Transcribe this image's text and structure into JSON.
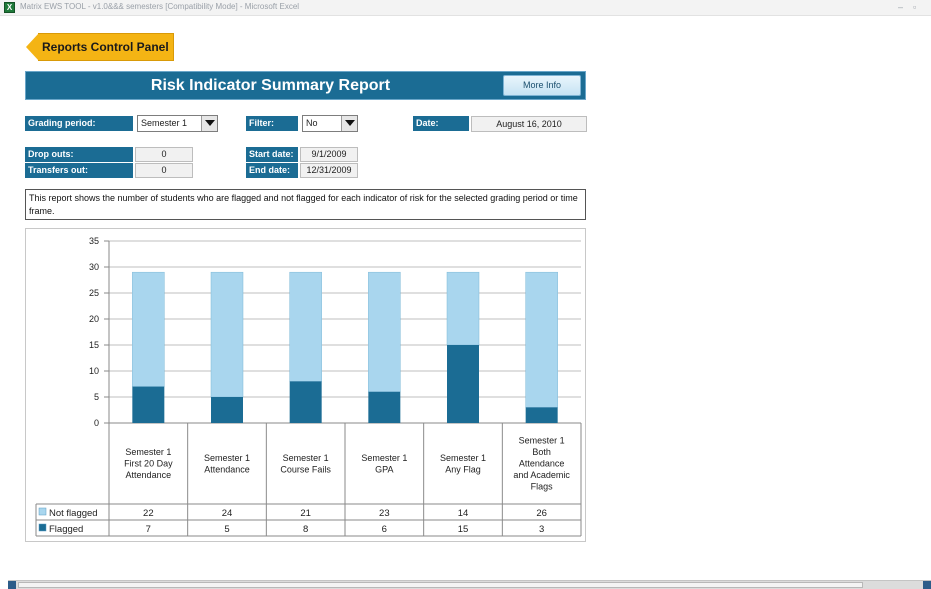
{
  "window": {
    "title": "Matrix EWS TOOL - v1.0&&& semesters [Compatibility Mode] - Microsoft Excel",
    "icon": "excel-icon"
  },
  "nav": {
    "reports_control_panel": "Reports Control Panel"
  },
  "report": {
    "title": "Risk Indicator Summary Report",
    "more_info": "More Info"
  },
  "filters": {
    "grading_period_label": "Grading period:",
    "grading_period_value": "Semester 1",
    "filter_label": "Filter:",
    "filter_value": "No",
    "date_label": "Date:",
    "date_value": "August 16, 2010"
  },
  "stats": {
    "drop_outs_label": "Drop outs:",
    "drop_outs_value": "0",
    "transfers_out_label": "Transfers out:",
    "transfers_out_value": "0",
    "start_date_label": "Start date:",
    "start_date_value": "9/1/2009",
    "end_date_label": "End date:",
    "end_date_value": "12/31/2009"
  },
  "description": "This report shows the number of students who are flagged and not flagged for each indicator of risk for the selected grading period or time frame.",
  "chart_data": {
    "type": "bar",
    "stacked": true,
    "categories": [
      "Semester 1 First 20 Day Attendance",
      "Semester 1 Attendance",
      "Semester 1 Course Fails",
      "Semester 1 GPA",
      "Semester 1 Any Flag",
      "Semester 1 Both Attendance and Academic Flags"
    ],
    "category_lines": [
      [
        "Semester 1",
        "First 20 Day",
        "Attendance"
      ],
      [
        "Semester 1",
        "Attendance"
      ],
      [
        "Semester 1",
        "Course Fails"
      ],
      [
        "Semester 1",
        "GPA"
      ],
      [
        "Semester 1",
        "Any Flag"
      ],
      [
        "Semester 1",
        "Both",
        "Attendance",
        "and Academic",
        "Flags"
      ]
    ],
    "series": [
      {
        "name": "Flagged",
        "values": [
          7,
          5,
          8,
          6,
          15,
          3
        ],
        "color": "#1b6c94"
      },
      {
        "name": "Not flagged",
        "values": [
          22,
          24,
          21,
          23,
          14,
          26
        ],
        "color": "#a9d6ee"
      }
    ],
    "ylim": [
      0,
      35
    ],
    "yticks": [
      0,
      5,
      10,
      15,
      20,
      25,
      30,
      35
    ],
    "grid": true,
    "legend": "data-table",
    "table_rows": [
      "Not flagged",
      "Flagged"
    ]
  }
}
